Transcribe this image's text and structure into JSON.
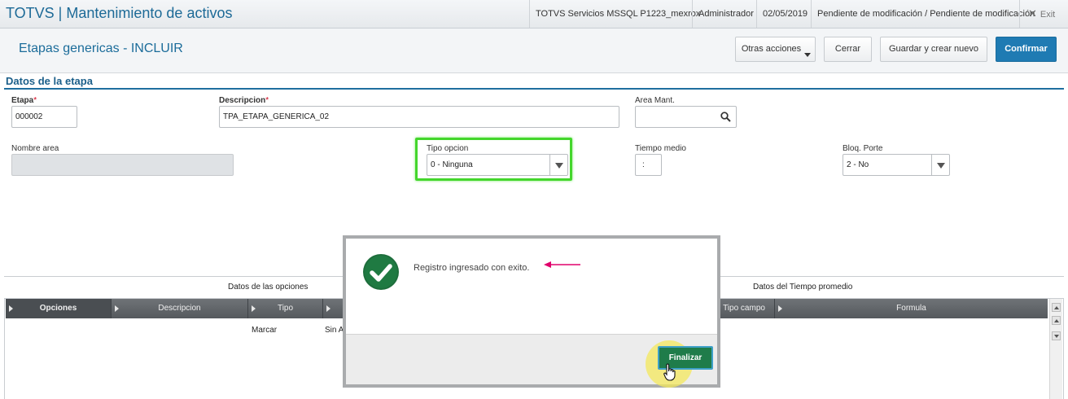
{
  "app": {
    "title": "TOTVS | Mantenimiento de activos",
    "environment": "TOTVS Servicios MSSQL P1223_mexrox",
    "user": "Administrador",
    "date": "02/05/2019",
    "status": "Pendiente de modificación / Pendiente de modificación",
    "exit_label": "Exit"
  },
  "page": {
    "title": "Etapas genericas - INCLUIR",
    "buttons": {
      "other_actions": "Otras acciones",
      "close": "Cerrar",
      "save_new": "Guardar y crear nuevo",
      "confirm": "Confirmar"
    }
  },
  "section": {
    "title": "Datos de la etapa"
  },
  "form": {
    "etapa": {
      "label": "Etapa",
      "required_mark": "*",
      "value": "000002"
    },
    "descripcion": {
      "label": "Descripcion",
      "required_mark": "*",
      "value": "TPA_ETAPA_GENERICA_02"
    },
    "area_mant": {
      "label": "Area Mant.",
      "value": ""
    },
    "nombre_area": {
      "label": "Nombre area",
      "value": ""
    },
    "tipo_opcion": {
      "label": "Tipo opcion",
      "value": "0 - Ninguna"
    },
    "tiempo_medio": {
      "label": "Tiempo medio",
      "value": ":"
    },
    "bloq_porte": {
      "label": "Bloq. Porte",
      "value": "2 - No"
    }
  },
  "tabs": {
    "options": "Datos de las opciones",
    "time": "Datos del Tiempo promedio"
  },
  "grid": {
    "headers": [
      "Opciones",
      "Descripcion",
      "Tipo",
      "Tipo campo",
      "Formula"
    ],
    "row": [
      "Marcar",
      "Sin A"
    ]
  },
  "modal": {
    "message": "Registro ingresado con exito.",
    "finalize_label": "Finalizar"
  },
  "colors": {
    "brand": "#1d6a97",
    "primary_button": "#1f7bb3",
    "success": "#1f7c4a",
    "highlight": "#44d62c",
    "annotation_arrow": "#e0006b"
  }
}
